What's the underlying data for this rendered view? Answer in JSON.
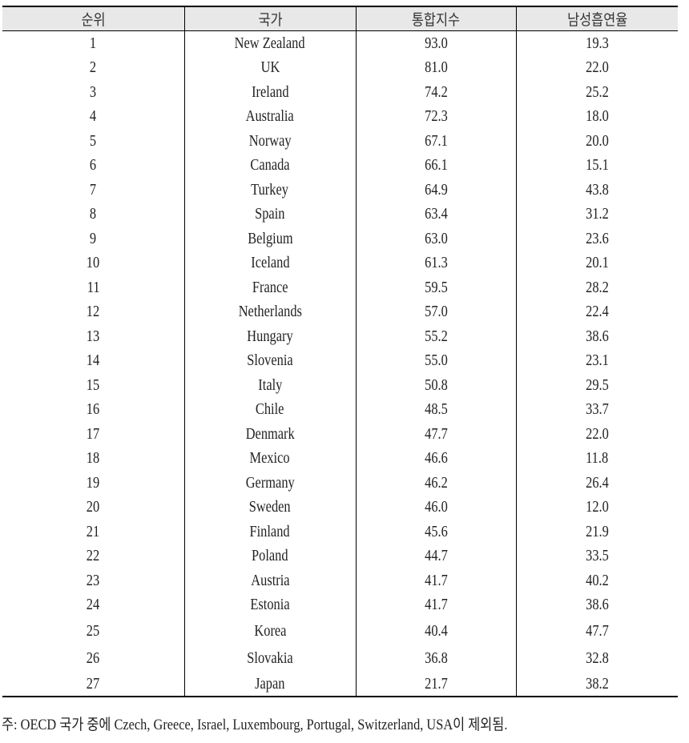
{
  "table": {
    "headers": [
      "순위",
      "국가",
      "통합지수",
      "남성흡연율"
    ],
    "rows": [
      {
        "rank": "1",
        "country": "New  Zealand",
        "index": "93.0",
        "smoking": "19.3"
      },
      {
        "rank": "2",
        "country": "UK",
        "index": "81.0",
        "smoking": "22.0"
      },
      {
        "rank": "3",
        "country": "Ireland",
        "index": "74.2",
        "smoking": "25.2"
      },
      {
        "rank": "4",
        "country": "Australia",
        "index": "72.3",
        "smoking": "18.0"
      },
      {
        "rank": "5",
        "country": "Norway",
        "index": "67.1",
        "smoking": "20.0"
      },
      {
        "rank": "6",
        "country": "Canada",
        "index": "66.1",
        "smoking": "15.1"
      },
      {
        "rank": "7",
        "country": "Turkey",
        "index": "64.9",
        "smoking": "43.8"
      },
      {
        "rank": "8",
        "country": "Spain",
        "index": "63.4",
        "smoking": "31.2"
      },
      {
        "rank": "9",
        "country": "Belgium",
        "index": "63.0",
        "smoking": "23.6"
      },
      {
        "rank": "10",
        "country": "Iceland",
        "index": "61.3",
        "smoking": "20.1"
      },
      {
        "rank": "11",
        "country": "France",
        "index": "59.5",
        "smoking": "28.2"
      },
      {
        "rank": "12",
        "country": "Netherlands",
        "index": "57.0",
        "smoking": "22.4"
      },
      {
        "rank": "13",
        "country": "Hungary",
        "index": "55.2",
        "smoking": "38.6"
      },
      {
        "rank": "14",
        "country": "Slovenia",
        "index": "55.0",
        "smoking": "23.1"
      },
      {
        "rank": "15",
        "country": "Italy",
        "index": "50.8",
        "smoking": "29.5"
      },
      {
        "rank": "16",
        "country": "Chile",
        "index": "48.5",
        "smoking": "33.7"
      },
      {
        "rank": "17",
        "country": "Denmark",
        "index": "47.7",
        "smoking": "22.0"
      },
      {
        "rank": "18",
        "country": "Mexico",
        "index": "46.6",
        "smoking": "11.8"
      },
      {
        "rank": "19",
        "country": "Germany",
        "index": "46.2",
        "smoking": "26.4"
      },
      {
        "rank": "20",
        "country": "Sweden",
        "index": "46.0",
        "smoking": "12.0"
      },
      {
        "rank": "21",
        "country": "Finland",
        "index": "45.6",
        "smoking": "21.9"
      },
      {
        "rank": "22",
        "country": "Poland",
        "index": "44.7",
        "smoking": "33.5"
      },
      {
        "rank": "23",
        "country": "Austria",
        "index": "41.7",
        "smoking": "40.2"
      },
      {
        "rank": "24",
        "country": "Estonia",
        "index": "41.7",
        "smoking": "38.6"
      },
      {
        "rank": "25",
        "country": "Korea",
        "index": "40.4",
        "smoking": "47.7"
      },
      {
        "rank": "26",
        "country": "Slovakia",
        "index": "36.8",
        "smoking": "32.8"
      },
      {
        "rank": "27",
        "country": "Japan",
        "index": "21.7",
        "smoking": "38.2"
      }
    ]
  },
  "footnote": "주: OECD 국가 중에 Czech, Greece, Israel, Luxembourg, Portugal, Switzerland, USA이 제외됨."
}
